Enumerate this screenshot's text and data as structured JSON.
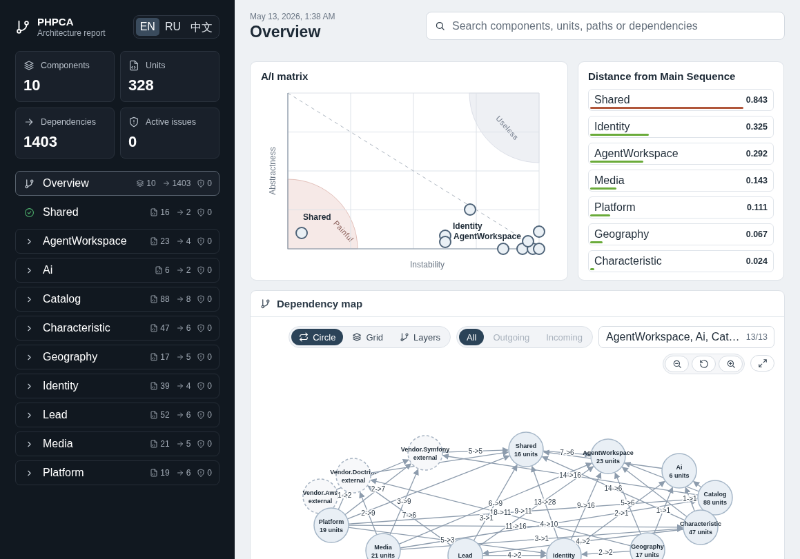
{
  "brand": {
    "title": "PHPCA",
    "subtitle": "Architecture report"
  },
  "languages": [
    {
      "label": "EN",
      "selected": true
    },
    {
      "label": "RU",
      "selected": false
    },
    {
      "label": "中文",
      "selected": false
    }
  ],
  "stats": [
    {
      "kind": "components",
      "label": "Components",
      "value": "10"
    },
    {
      "kind": "units",
      "label": "Units",
      "value": "328"
    },
    {
      "kind": "dependencies",
      "label": "Dependencies",
      "value": "1403"
    },
    {
      "kind": "issues",
      "label": "Active issues",
      "value": "0"
    }
  ],
  "nav": {
    "overview": {
      "label": "Overview",
      "selected": true,
      "components": "10",
      "dependencies": "1403",
      "issues": "0"
    },
    "components": [
      {
        "name": "Shared",
        "kind": "check",
        "units": "16",
        "dependencies": "2",
        "issues": "0"
      },
      {
        "name": "AgentWorkspace",
        "kind": "group",
        "units": "23",
        "dependencies": "4",
        "issues": "0"
      },
      {
        "name": "Ai",
        "kind": "group",
        "units": "6",
        "dependencies": "2",
        "issues": "0"
      },
      {
        "name": "Catalog",
        "kind": "group",
        "units": "88",
        "dependencies": "8",
        "issues": "0"
      },
      {
        "name": "Characteristic",
        "kind": "group",
        "units": "47",
        "dependencies": "6",
        "issues": "0"
      },
      {
        "name": "Geography",
        "kind": "group",
        "units": "17",
        "dependencies": "5",
        "issues": "0"
      },
      {
        "name": "Identity",
        "kind": "group",
        "units": "39",
        "dependencies": "4",
        "issues": "0"
      },
      {
        "name": "Lead",
        "kind": "group",
        "units": "52",
        "dependencies": "6",
        "issues": "0"
      },
      {
        "name": "Media",
        "kind": "group",
        "units": "21",
        "dependencies": "5",
        "issues": "0"
      },
      {
        "name": "Platform",
        "kind": "group",
        "units": "19",
        "dependencies": "6",
        "issues": "0"
      }
    ]
  },
  "header": {
    "date": "May 13, 2026, 1:38 AM",
    "title": "Overview"
  },
  "search": {
    "placeholder": "Search components, units, paths or dependencies"
  },
  "ai_matrix": {
    "title": "A/I matrix",
    "xlabel": "Instability",
    "ylabel": "Abstractness",
    "zones": [
      {
        "kind": "painful",
        "label": "Painful"
      },
      {
        "kind": "useless",
        "label": "Useless"
      }
    ],
    "point_labels": [
      "Shared",
      "Identity",
      "AgentWorkspace"
    ]
  },
  "distance": {
    "title": "Distance from Main Sequence",
    "items": [
      {
        "name": "Shared",
        "value": "0.843",
        "level": 0.843,
        "color": "#b0563a"
      },
      {
        "name": "Identity",
        "value": "0.325",
        "level": 0.325,
        "color": "#6aab3a"
      },
      {
        "name": "AgentWorkspace",
        "value": "0.292",
        "level": 0.292,
        "color": "#6aab3a"
      },
      {
        "name": "Media",
        "value": "0.143",
        "level": 0.143,
        "color": "#6aab3a"
      },
      {
        "name": "Platform",
        "value": "0.111",
        "level": 0.111,
        "color": "#6aab3a"
      },
      {
        "name": "Geography",
        "value": "0.067",
        "level": 0.067,
        "color": "#6aab3a"
      },
      {
        "name": "Characteristic",
        "value": "0.024",
        "level": 0.024,
        "color": "#6aab3a"
      }
    ]
  },
  "dependency_map": {
    "title": "Dependency map",
    "layouts": [
      {
        "kind": "circle",
        "label": "Circle",
        "selected": true
      },
      {
        "kind": "grid",
        "label": "Grid",
        "selected": false
      },
      {
        "kind": "layers",
        "label": "Layers",
        "selected": false
      }
    ],
    "directions": [
      {
        "label": "All",
        "selected": true
      },
      {
        "label": "Outgoing",
        "selected": false
      },
      {
        "label": "Incoming",
        "selected": false
      }
    ],
    "filter": {
      "value": "AgentWorkspace, Ai, Cat…",
      "count": "13/13"
    },
    "nodes": [
      {
        "name": "Vendor.Symfony",
        "units": "external",
        "kind": "external"
      },
      {
        "name": "Shared",
        "units": "16 units",
        "kind": "component"
      },
      {
        "name": "AgentWorkspace",
        "units": "23 units",
        "kind": "component"
      },
      {
        "name": "Vendor.Doctri…",
        "units": "external",
        "kind": "external"
      },
      {
        "name": "Ai",
        "units": "6 units",
        "kind": "component"
      },
      {
        "name": "Vendor.Aws",
        "units": "external",
        "kind": "external"
      },
      {
        "name": "Catalog",
        "units": "88 units",
        "kind": "component"
      },
      {
        "name": "Platform",
        "units": "19 units",
        "kind": "component"
      },
      {
        "name": "Characteristic",
        "units": "47 units",
        "kind": "component"
      },
      {
        "name": "Media",
        "units": "21 units",
        "kind": "component"
      },
      {
        "name": "Lead",
        "kind": "component"
      },
      {
        "name": "Identity",
        "kind": "component"
      },
      {
        "name": "Geography",
        "units": "17 units",
        "kind": "component"
      }
    ],
    "edges": [
      {
        "label": "5->5"
      },
      {
        "label": "7->6"
      },
      {
        "label": "1->2"
      },
      {
        "label": "2->7"
      },
      {
        "label": "2->9"
      },
      {
        "label": "3->9"
      },
      {
        "label": "7->6"
      },
      {
        "label": "14->16"
      },
      {
        "label": "18->11"
      },
      {
        "label": "9->16"
      },
      {
        "label": "1->1"
      },
      {
        "label": "14->6"
      },
      {
        "label": "6->9"
      },
      {
        "label": "3->1"
      },
      {
        "label": "9->11"
      },
      {
        "label": "11->16"
      },
      {
        "label": "4->10"
      },
      {
        "label": "13->28"
      },
      {
        "label": "5->6"
      },
      {
        "label": "4->2"
      },
      {
        "label": "2->1"
      },
      {
        "label": "5->3"
      },
      {
        "label": "1->1"
      },
      {
        "label": "3->1"
      },
      {
        "label": "2->2"
      },
      {
        "label": "4->2"
      }
    ]
  }
}
